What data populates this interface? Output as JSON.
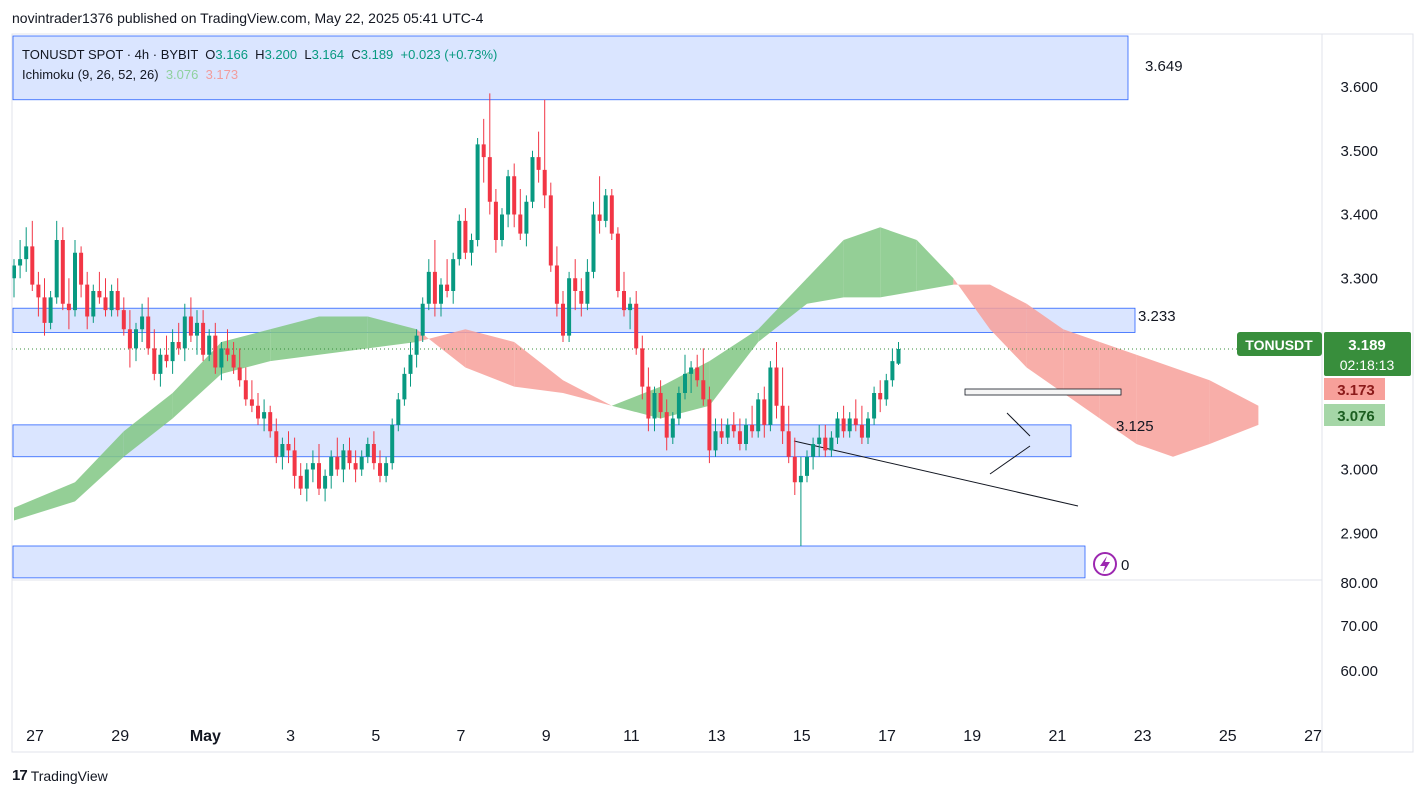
{
  "publish_line": "novintrader1376 published on TradingView.com, May 22, 2025 05:41 UTC-4",
  "legend": {
    "symbol": "TONUSDT SPOT · 4h · BYBIT",
    "o_label": "O",
    "o": "3.166",
    "h_label": "H",
    "h": "3.200",
    "l_label": "L",
    "l": "3.164",
    "c_label": "C",
    "c": "3.189",
    "change": "+0.023 (+0.73%)",
    "indicator": "Ichimoku (9, 26, 52, 26)",
    "span_a": "3.076",
    "span_b": "3.173"
  },
  "footer": {
    "brand": "TradingView",
    "logo_glyph": "17"
  },
  "colors": {
    "up": "#089981",
    "down": "#f23645",
    "cloud_up": "#81c784",
    "cloud_down": "#f7a09a",
    "zone_fill": "#d6e2ff",
    "zone_stroke": "#2962ff",
    "last_price_bg": "#388e3c"
  },
  "chart_data": {
    "type": "candlestick",
    "title": "TONUSDT SPOT · 4h · BYBIT",
    "ylim": [
      2.8,
      3.68
    ],
    "y_ticks": [
      "3.600",
      "3.500",
      "3.400",
      "3.300",
      "3.000",
      "2.900"
    ],
    "x_ticks": [
      "27",
      "29",
      "May",
      "3",
      "5",
      "7",
      "9",
      "11",
      "13",
      "15",
      "17",
      "19",
      "21",
      "23",
      "25",
      "27"
    ],
    "lower_pane_ticks": [
      "80.00",
      "70.00",
      "60.00"
    ],
    "price_labels": {
      "zone_top": "3.649",
      "zone_mid": "3.233",
      "zone_low": "3.125",
      "clipped": "0"
    },
    "last_price": {
      "symbol": "TONUSDT",
      "value": "3.189",
      "countdown": "02:18:13"
    },
    "span_b_label": "3.173",
    "span_a_label": "3.076",
    "candles": [
      [
        3.3,
        3.33,
        3.27,
        3.32
      ],
      [
        3.32,
        3.36,
        3.3,
        3.33
      ],
      [
        3.33,
        3.38,
        3.31,
        3.35
      ],
      [
        3.35,
        3.39,
        3.28,
        3.29
      ],
      [
        3.29,
        3.31,
        3.24,
        3.27
      ],
      [
        3.27,
        3.3,
        3.21,
        3.23
      ],
      [
        3.23,
        3.28,
        3.22,
        3.27
      ],
      [
        3.27,
        3.39,
        3.26,
        3.36
      ],
      [
        3.36,
        3.38,
        3.25,
        3.26
      ],
      [
        3.26,
        3.3,
        3.22,
        3.25
      ],
      [
        3.25,
        3.36,
        3.24,
        3.34
      ],
      [
        3.34,
        3.35,
        3.27,
        3.29
      ],
      [
        3.29,
        3.31,
        3.22,
        3.24
      ],
      [
        3.24,
        3.29,
        3.23,
        3.28
      ],
      [
        3.28,
        3.31,
        3.26,
        3.27
      ],
      [
        3.27,
        3.3,
        3.24,
        3.25
      ],
      [
        3.25,
        3.29,
        3.24,
        3.28
      ],
      [
        3.28,
        3.3,
        3.24,
        3.25
      ],
      [
        3.25,
        3.27,
        3.21,
        3.22
      ],
      [
        3.22,
        3.25,
        3.16,
        3.19
      ],
      [
        3.19,
        3.23,
        3.17,
        3.22
      ],
      [
        3.22,
        3.26,
        3.2,
        3.24
      ],
      [
        3.24,
        3.27,
        3.18,
        3.19
      ],
      [
        3.19,
        3.22,
        3.14,
        3.15
      ],
      [
        3.15,
        3.19,
        3.13,
        3.18
      ],
      [
        3.18,
        3.21,
        3.16,
        3.17
      ],
      [
        3.17,
        3.22,
        3.15,
        3.2
      ],
      [
        3.2,
        3.23,
        3.18,
        3.19
      ],
      [
        3.19,
        3.26,
        3.17,
        3.24
      ],
      [
        3.24,
        3.27,
        3.2,
        3.21
      ],
      [
        3.21,
        3.25,
        3.18,
        3.23
      ],
      [
        3.23,
        3.25,
        3.17,
        3.18
      ],
      [
        3.18,
        3.22,
        3.17,
        3.21
      ],
      [
        3.21,
        3.23,
        3.15,
        3.16
      ],
      [
        3.16,
        3.2,
        3.14,
        3.19
      ],
      [
        3.19,
        3.22,
        3.17,
        3.18
      ],
      [
        3.18,
        3.2,
        3.15,
        3.16
      ],
      [
        3.16,
        3.19,
        3.13,
        3.14
      ],
      [
        3.14,
        3.16,
        3.1,
        3.11
      ],
      [
        3.11,
        3.14,
        3.09,
        3.1
      ],
      [
        3.1,
        3.12,
        3.07,
        3.08
      ],
      [
        3.08,
        3.11,
        3.06,
        3.09
      ],
      [
        3.09,
        3.1,
        3.05,
        3.06
      ],
      [
        3.06,
        3.08,
        3.01,
        3.02
      ],
      [
        3.02,
        3.05,
        3.0,
        3.04
      ],
      [
        3.04,
        3.06,
        3.01,
        3.03
      ],
      [
        3.03,
        3.05,
        2.97,
        2.99
      ],
      [
        2.99,
        3.01,
        2.96,
        2.97
      ],
      [
        2.97,
        3.01,
        2.95,
        3.0
      ],
      [
        3.0,
        3.03,
        2.98,
        3.01
      ],
      [
        3.01,
        3.04,
        2.96,
        2.97
      ],
      [
        2.97,
        3.0,
        2.95,
        2.99
      ],
      [
        2.99,
        3.03,
        2.97,
        3.02
      ],
      [
        3.02,
        3.05,
        2.99,
        3.0
      ],
      [
        3.0,
        3.04,
        2.98,
        3.03
      ],
      [
        3.03,
        3.05,
        3.0,
        3.01
      ],
      [
        3.01,
        3.03,
        2.98,
        3.0
      ],
      [
        3.0,
        3.03,
        2.99,
        3.02
      ],
      [
        3.02,
        3.05,
        3.01,
        3.04
      ],
      [
        3.04,
        3.06,
        3.0,
        3.01
      ],
      [
        3.01,
        3.03,
        2.98,
        2.99
      ],
      [
        2.99,
        3.02,
        2.98,
        3.01
      ],
      [
        3.01,
        3.08,
        3.0,
        3.07
      ],
      [
        3.07,
        3.12,
        3.06,
        3.11
      ],
      [
        3.11,
        3.16,
        3.1,
        3.15
      ],
      [
        3.15,
        3.2,
        3.13,
        3.18
      ],
      [
        3.18,
        3.22,
        3.16,
        3.21
      ],
      [
        3.21,
        3.27,
        3.2,
        3.26
      ],
      [
        3.26,
        3.33,
        3.25,
        3.31
      ],
      [
        3.31,
        3.36,
        3.24,
        3.26
      ],
      [
        3.26,
        3.3,
        3.24,
        3.29
      ],
      [
        3.29,
        3.33,
        3.27,
        3.28
      ],
      [
        3.28,
        3.34,
        3.26,
        3.33
      ],
      [
        3.33,
        3.4,
        3.32,
        3.39
      ],
      [
        3.39,
        3.41,
        3.33,
        3.34
      ],
      [
        3.34,
        3.37,
        3.32,
        3.36
      ],
      [
        3.36,
        3.52,
        3.35,
        3.51
      ],
      [
        3.51,
        3.55,
        3.45,
        3.49
      ],
      [
        3.49,
        3.59,
        3.4,
        3.42
      ],
      [
        3.42,
        3.44,
        3.34,
        3.36
      ],
      [
        3.36,
        3.41,
        3.35,
        3.4
      ],
      [
        3.4,
        3.47,
        3.38,
        3.46
      ],
      [
        3.46,
        3.48,
        3.38,
        3.4
      ],
      [
        3.4,
        3.44,
        3.36,
        3.37
      ],
      [
        3.37,
        3.43,
        3.35,
        3.42
      ],
      [
        3.42,
        3.5,
        3.41,
        3.49
      ],
      [
        3.49,
        3.53,
        3.45,
        3.47
      ],
      [
        3.47,
        3.58,
        3.41,
        3.43
      ],
      [
        3.43,
        3.45,
        3.31,
        3.32
      ],
      [
        3.32,
        3.35,
        3.24,
        3.26
      ],
      [
        3.26,
        3.28,
        3.2,
        3.21
      ],
      [
        3.21,
        3.31,
        3.2,
        3.3
      ],
      [
        3.3,
        3.33,
        3.25,
        3.28
      ],
      [
        3.28,
        3.3,
        3.24,
        3.26
      ],
      [
        3.26,
        3.33,
        3.25,
        3.31
      ],
      [
        3.31,
        3.42,
        3.3,
        3.4
      ],
      [
        3.4,
        3.46,
        3.37,
        3.39
      ],
      [
        3.39,
        3.44,
        3.38,
        3.43
      ],
      [
        3.43,
        3.44,
        3.36,
        3.37
      ],
      [
        3.37,
        3.38,
        3.27,
        3.28
      ],
      [
        3.28,
        3.31,
        3.24,
        3.25
      ],
      [
        3.25,
        3.27,
        3.22,
        3.26
      ],
      [
        3.26,
        3.28,
        3.18,
        3.19
      ],
      [
        3.19,
        3.21,
        3.11,
        3.13
      ],
      [
        3.13,
        3.16,
        3.06,
        3.08
      ],
      [
        3.08,
        3.13,
        3.06,
        3.12
      ],
      [
        3.12,
        3.14,
        3.08,
        3.09
      ],
      [
        3.09,
        3.11,
        3.03,
        3.05
      ],
      [
        3.05,
        3.09,
        3.04,
        3.08
      ],
      [
        3.08,
        3.13,
        3.07,
        3.12
      ],
      [
        3.12,
        3.18,
        3.11,
        3.15
      ],
      [
        3.15,
        3.17,
        3.12,
        3.16
      ],
      [
        3.16,
        3.18,
        3.13,
        3.14
      ],
      [
        3.14,
        3.19,
        3.1,
        3.11
      ],
      [
        3.11,
        3.13,
        3.01,
        3.03
      ],
      [
        3.03,
        3.08,
        3.02,
        3.06
      ],
      [
        3.06,
        3.08,
        3.04,
        3.05
      ],
      [
        3.05,
        3.08,
        3.04,
        3.07
      ],
      [
        3.07,
        3.09,
        3.05,
        3.06
      ],
      [
        3.06,
        3.08,
        3.03,
        3.04
      ],
      [
        3.04,
        3.08,
        3.03,
        3.07
      ],
      [
        3.07,
        3.1,
        3.05,
        3.06
      ],
      [
        3.06,
        3.12,
        3.05,
        3.11
      ],
      [
        3.11,
        3.13,
        3.05,
        3.07
      ],
      [
        3.07,
        3.17,
        3.06,
        3.16
      ],
      [
        3.16,
        3.2,
        3.08,
        3.1
      ],
      [
        3.1,
        3.16,
        3.04,
        3.06
      ],
      [
        3.06,
        3.1,
        3.01,
        3.02
      ],
      [
        3.02,
        3.05,
        2.96,
        2.98
      ],
      [
        2.98,
        3.02,
        2.88,
        2.99
      ],
      [
        2.99,
        3.03,
        2.98,
        3.02
      ],
      [
        3.02,
        3.05,
        3.0,
        3.04
      ],
      [
        3.04,
        3.07,
        3.02,
        3.05
      ],
      [
        3.05,
        3.07,
        3.02,
        3.03
      ],
      [
        3.03,
        3.06,
        3.02,
        3.05
      ],
      [
        3.05,
        3.09,
        3.04,
        3.08
      ],
      [
        3.08,
        3.1,
        3.05,
        3.06
      ],
      [
        3.06,
        3.09,
        3.05,
        3.08
      ],
      [
        3.08,
        3.11,
        3.06,
        3.07
      ],
      [
        3.07,
        3.1,
        3.04,
        3.05
      ],
      [
        3.05,
        3.09,
        3.04,
        3.08
      ],
      [
        3.08,
        3.13,
        3.07,
        3.12
      ],
      [
        3.12,
        3.14,
        3.09,
        3.11
      ],
      [
        3.11,
        3.15,
        3.1,
        3.14
      ],
      [
        3.14,
        3.19,
        3.13,
        3.17
      ],
      [
        3.166,
        3.2,
        3.164,
        3.189
      ]
    ],
    "cloud_span_a": [
      [
        0,
        2.94
      ],
      [
        10,
        2.98
      ],
      [
        18,
        3.06
      ],
      [
        26,
        3.12
      ],
      [
        34,
        3.2
      ],
      [
        42,
        3.22
      ],
      [
        50,
        3.24
      ],
      [
        58,
        3.24
      ],
      [
        66,
        3.22
      ],
      [
        74,
        3.16
      ],
      [
        82,
        3.13
      ],
      [
        90,
        3.12
      ],
      [
        98,
        3.1
      ],
      [
        106,
        3.13
      ],
      [
        114,
        3.17
      ],
      [
        122,
        3.22
      ],
      [
        130,
        3.3
      ],
      [
        136,
        3.36
      ],
      [
        142,
        3.38
      ],
      [
        148,
        3.36
      ],
      [
        154,
        3.3
      ],
      [
        160,
        3.22
      ],
      [
        166,
        3.16
      ],
      [
        172,
        3.12
      ],
      [
        178,
        3.08
      ],
      [
        184,
        3.04
      ],
      [
        190,
        3.02
      ],
      [
        196,
        3.04
      ],
      [
        204,
        3.07
      ]
    ],
    "cloud_span_b": [
      [
        0,
        2.92
      ],
      [
        10,
        2.95
      ],
      [
        18,
        3.02
      ],
      [
        26,
        3.08
      ],
      [
        34,
        3.15
      ],
      [
        42,
        3.17
      ],
      [
        50,
        3.18
      ],
      [
        58,
        3.19
      ],
      [
        66,
        3.2
      ],
      [
        74,
        3.22
      ],
      [
        82,
        3.2
      ],
      [
        90,
        3.14
      ],
      [
        98,
        3.1
      ],
      [
        106,
        3.08
      ],
      [
        114,
        3.1
      ],
      [
        122,
        3.2
      ],
      [
        130,
        3.26
      ],
      [
        136,
        3.27
      ],
      [
        142,
        3.27
      ],
      [
        148,
        3.28
      ],
      [
        154,
        3.29
      ],
      [
        160,
        3.29
      ],
      [
        166,
        3.26
      ],
      [
        172,
        3.22
      ],
      [
        178,
        3.2
      ],
      [
        184,
        3.18
      ],
      [
        190,
        3.16
      ],
      [
        196,
        3.14
      ],
      [
        204,
        3.1
      ]
    ],
    "zones": [
      {
        "name": "zone-top",
        "from": 3.58,
        "to": 3.68
      },
      {
        "name": "zone-mid",
        "from": 3.215,
        "to": 3.253
      },
      {
        "name": "zone-low",
        "from": 3.02,
        "to": 3.07
      },
      {
        "name": "zone-bottom",
        "from": 2.83,
        "to": 2.88
      }
    ]
  }
}
